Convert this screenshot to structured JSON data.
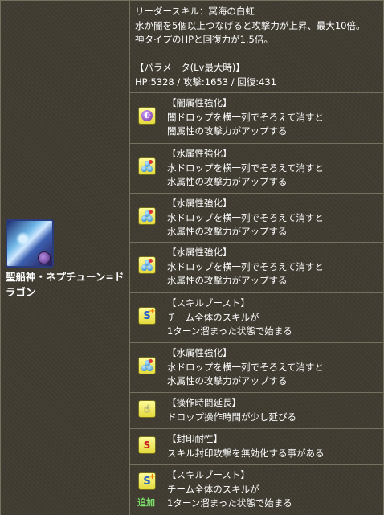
{
  "monster": {
    "name": "聖船神・ネプチューン=ドラゴン",
    "icon": "neptune-dragon-portrait",
    "attribute_badge": "dark-orb-badge"
  },
  "leader_skill": {
    "label": "リーダースキル：冥海の白虹",
    "line1": "水か闇を5個以上つなげると攻撃力が上昇、最大10倍。",
    "line2": "神タイプのHPと回復力が1.5倍。"
  },
  "parameters": {
    "heading": "【パラメータ(Lv最大時)】",
    "stats": "HP:5328 / 攻撃:1653 / 回復:431"
  },
  "awakenings": [
    {
      "icon": "dark-enhance-icon",
      "title": "【闇属性強化】",
      "lines": [
        "闇ドロップを横一列でそろえて消すと",
        "闇属性の攻撃力がアップする"
      ]
    },
    {
      "icon": "water-enhance-icon",
      "title": "【水属性強化】",
      "lines": [
        "水ドロップを横一列でそろえて消すと",
        "水属性の攻撃力がアップする"
      ]
    },
    {
      "icon": "water-enhance-icon",
      "title": "【水属性強化】",
      "lines": [
        "水ドロップを横一列でそろえて消すと",
        "水属性の攻撃力がアップする"
      ]
    },
    {
      "icon": "water-enhance-icon",
      "title": "【水属性強化】",
      "lines": [
        "水ドロップを横一列でそろえて消すと",
        "水属性の攻撃力がアップする"
      ]
    },
    {
      "icon": "skill-boost-icon",
      "title": "【スキルブースト】",
      "lines": [
        "チーム全体のスキルが",
        "1ターン溜まった状態で始まる"
      ]
    },
    {
      "icon": "water-enhance-icon",
      "title": "【水属性強化】",
      "lines": [
        "水ドロップを横一列でそろえて消すと",
        "水属性の攻撃力がアップする"
      ]
    },
    {
      "icon": "extend-time-icon",
      "title": "【操作時間延長】",
      "lines": [
        "ドロップ操作時間が少し延びる"
      ]
    },
    {
      "icon": "seal-resist-icon",
      "title": "【封印耐性】",
      "lines": [
        "スキル封印攻撃を無効化する事がある"
      ]
    },
    {
      "icon": "skill-boost-icon",
      "title": "【スキルブースト】",
      "lines": [
        "チーム全体のスキルが",
        "1ターン溜まった状態で始まる"
      ],
      "tag": "追加"
    }
  ]
}
